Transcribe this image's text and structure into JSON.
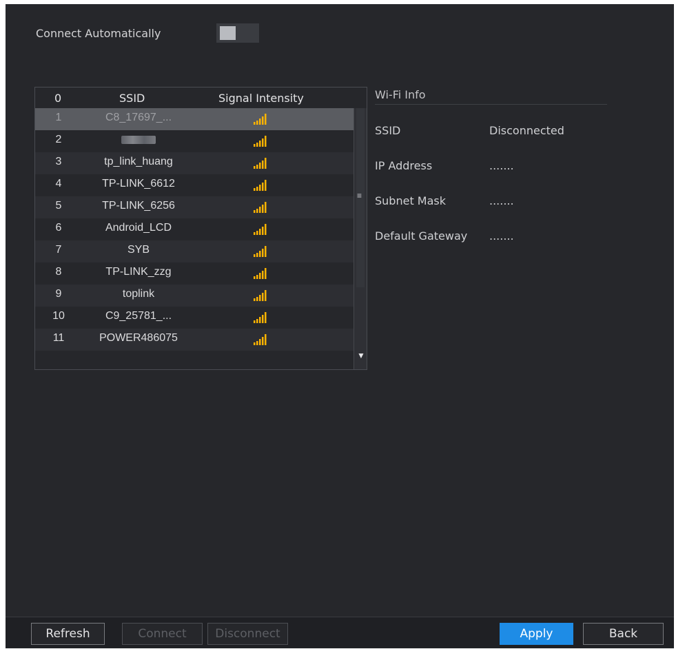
{
  "connect_auto": {
    "label": "Connect Automatically",
    "enabled": false
  },
  "list": {
    "headers": {
      "num": "0",
      "ssid": "SSID",
      "signal": "Signal Intensity"
    },
    "rows": [
      {
        "num": "1",
        "ssid": "C8_17697_...",
        "selected": true
      },
      {
        "num": "2",
        "ssid": "",
        "blurred": true
      },
      {
        "num": "3",
        "ssid": "tp_link_huang"
      },
      {
        "num": "4",
        "ssid": "TP-LINK_6612"
      },
      {
        "num": "5",
        "ssid": "TP-LINK_6256"
      },
      {
        "num": "6",
        "ssid": "Android_LCD"
      },
      {
        "num": "7",
        "ssid": "SYB"
      },
      {
        "num": "8",
        "ssid": "TP-LINK_zzg"
      },
      {
        "num": "9",
        "ssid": "toplink"
      },
      {
        "num": "10",
        "ssid": "C9_25781_..."
      },
      {
        "num": "11",
        "ssid": "POWER486075"
      }
    ]
  },
  "wifi_info": {
    "title": "Wi-Fi Info",
    "fields": [
      {
        "label": "SSID",
        "value": "Disconnected"
      },
      {
        "label": "IP Address",
        "value": "......."
      },
      {
        "label": "Subnet Mask",
        "value": "......."
      },
      {
        "label": "Default Gateway",
        "value": "......."
      }
    ]
  },
  "buttons": {
    "refresh": "Refresh",
    "connect": "Connect",
    "disconnect": "Disconnect",
    "apply": "Apply",
    "back": "Back"
  },
  "colors": {
    "accent": "#1e8ce6",
    "signal": "#ffb400",
    "background": "#26272b"
  }
}
